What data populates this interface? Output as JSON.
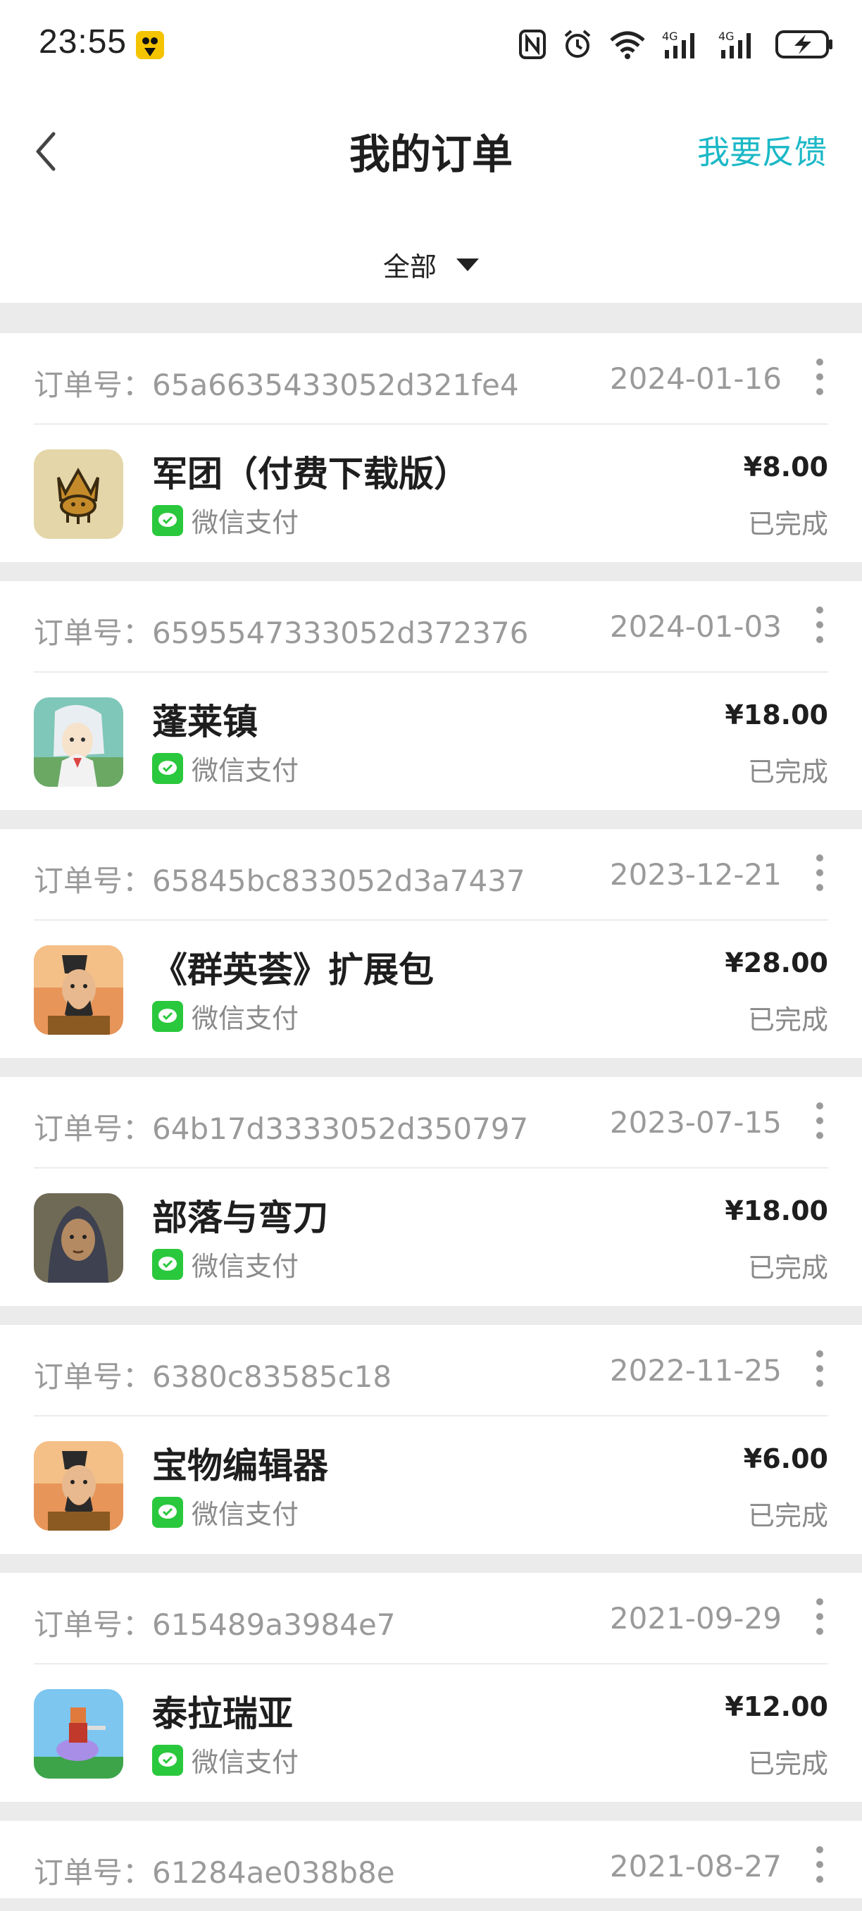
{
  "status_bar": {
    "time": "23:55",
    "icons": [
      "app-notification-icon",
      "nfc-icon",
      "alarm-icon",
      "wifi-icon",
      "signal-4g-icon",
      "signal-4g-icon",
      "battery-charging-icon"
    ]
  },
  "header": {
    "title": "我的订单",
    "feedback_label": "我要反馈",
    "filter_label": "全部"
  },
  "colors": {
    "accent": "#1bb8c6",
    "wechat_green": "#2ac83c",
    "muted_text": "#9a9a9a"
  },
  "orders": [
    {
      "order_label": "订单号：65a6635433052d321fe4",
      "date": "2024-01-16",
      "name": "军团（付费下载版）",
      "payment": "微信支付",
      "price": "¥8.00",
      "status": "已完成",
      "icon": "legion-crown-icon"
    },
    {
      "order_label": "订单号：6595547333052d372376",
      "date": "2024-01-03",
      "name": "蓬莱镇",
      "payment": "微信支付",
      "price": "¥18.00",
      "status": "已完成",
      "icon": "penglai-character-icon"
    },
    {
      "order_label": "订单号：65845bc833052d3a7437",
      "date": "2023-12-21",
      "name": "《群英荟》扩展包",
      "payment": "微信支付",
      "price": "¥28.00",
      "status": "已完成",
      "icon": "han-general-icon"
    },
    {
      "order_label": "订单号：64b17d3333052d350797",
      "date": "2023-07-15",
      "name": "部落与弯刀",
      "payment": "微信支付",
      "price": "¥18.00",
      "status": "已完成",
      "icon": "tribe-portrait-icon"
    },
    {
      "order_label": "订单号：6380c83585c18",
      "date": "2022-11-25",
      "name": "宝物编辑器",
      "payment": "微信支付",
      "price": "¥6.00",
      "status": "已完成",
      "icon": "han-general-icon"
    },
    {
      "order_label": "订单号：615489a3984e7",
      "date": "2021-09-29",
      "name": "泰拉瑞亚",
      "payment": "微信支付",
      "price": "¥12.00",
      "status": "已完成",
      "icon": "terraria-icon"
    },
    {
      "order_label": "订单号：61284ae038b8e",
      "date": "2021-08-27"
    }
  ]
}
